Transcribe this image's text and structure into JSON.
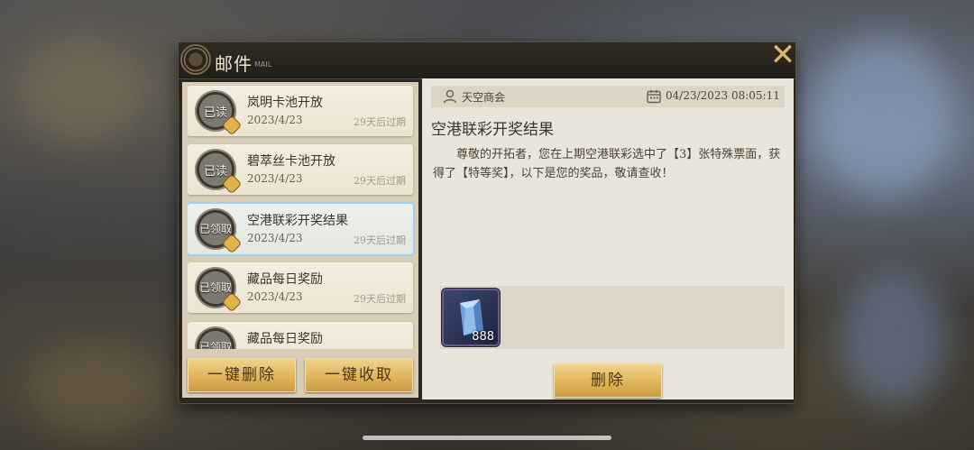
{
  "window": {
    "title": "邮件",
    "subtitle": "MAIL",
    "close_label": "✕"
  },
  "mail_list": [
    {
      "title": "岚明卡池开放",
      "date": "2023/4/23",
      "expire": "29天后过期",
      "status": "已读"
    },
    {
      "title": "碧萃丝卡池开放",
      "date": "2023/4/23",
      "expire": "29天后过期",
      "status": "已读"
    },
    {
      "title": "空港联彩开奖结果",
      "date": "2023/4/23",
      "expire": "29天后过期",
      "status": "已领取"
    },
    {
      "title": "藏品每日奖励",
      "date": "2023/4/23",
      "expire": "29天后过期",
      "status": "已领取"
    },
    {
      "title": "藏品每日奖励",
      "date": "",
      "expire": "",
      "status": "已领取"
    }
  ],
  "buttons": {
    "delete_all": "一键删除",
    "claim_all": "一键收取",
    "delete": "删除"
  },
  "detail": {
    "sender": "天空商会",
    "timestamp": "04/23/2023 08:05:11",
    "title": "空港联彩开奖结果",
    "body": "尊敬的开拓者，您在上期空港联彩选中了【3】张特殊票面，获得了【特等奖】，以下是您的奖品，敬请查收！",
    "reward": {
      "icon": "crystal-cube-icon",
      "count": "888"
    }
  },
  "colors": {
    "accent_gold": "#e1b55c",
    "selected_outline": "#9fd2f0"
  }
}
